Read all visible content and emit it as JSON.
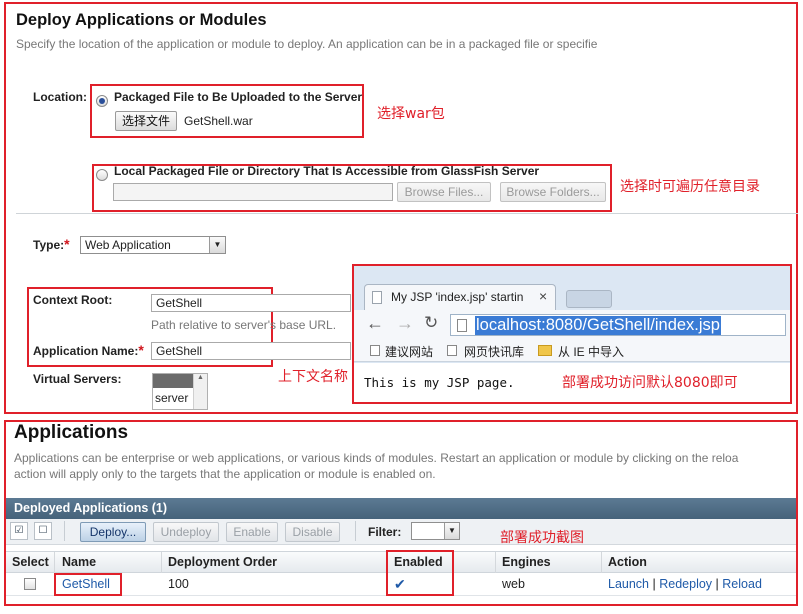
{
  "deploy": {
    "title": "Deploy Applications or Modules",
    "description": "Specify the location of the application or module to deploy. An application can be in a packaged file or specifie",
    "location_label": "Location:",
    "option_upload": "Packaged File to Be Uploaded to the Server",
    "choose_file_button": "选择文件",
    "chosen_file": "GetShell.war",
    "option_local": "Local Packaged File or Directory That Is Accessible from GlassFish Server",
    "browse_files_button": "Browse Files...",
    "browse_folders_button": "Browse Folders...",
    "type_label": "Type:",
    "type_value": "Web Application",
    "context_root_label": "Context Root:",
    "context_root_value": "GetShell",
    "context_root_help": "Path relative to server's base URL.",
    "app_name_label": "Application Name:",
    "app_name_value": "GetShell",
    "virtual_servers_label": "Virtual Servers:",
    "virtual_server_item": "server",
    "required_mark": "*"
  },
  "annotations": {
    "choose_war": "选择war包",
    "browse_any_dir": "选择时可遍历任意目录",
    "context_name": "上下文名称",
    "deploy_success_access": "部署成功访问默认8080即可",
    "deploy_success_shot": "部署成功截图"
  },
  "browser": {
    "tab_title": "My JSP 'index.jsp' startin",
    "tab_close": "×",
    "url": "localhost:8080/GetShell/index.jsp",
    "bookmarks": [
      "建议网站",
      "网页快讯库",
      "从 IE 中导入"
    ],
    "page_text": "This is my JSP page."
  },
  "applications": {
    "title": "Applications",
    "description_line1": "Applications can be enterprise or web applications, or various kinds of modules. Restart an application or module by clicking on the reloa",
    "description_line2": "action will apply only to the targets that the application or module is enabled on.",
    "table_title": "Deployed Applications (1)",
    "toolbar": {
      "deploy": "Deploy...",
      "undeploy": "Undeploy",
      "enable": "Enable",
      "disable": "Disable",
      "filter_label": "Filter:"
    },
    "columns": [
      "Select",
      "Name",
      "Deployment Order",
      "Enabled",
      "Engines",
      "Action"
    ],
    "row": {
      "name": "GetShell",
      "deployment_order": "100",
      "enabled": "✔",
      "engines": "web",
      "action_launch": "Launch",
      "action_sep": "|",
      "action_redeploy": "Redeploy",
      "action_reload": "Reload"
    }
  },
  "colors": {
    "annotation_red": "#e0202a",
    "table_header_bg": "#4f6c85",
    "link_blue": "#1f5aa8",
    "url_highlight": "#3a7bd5"
  }
}
